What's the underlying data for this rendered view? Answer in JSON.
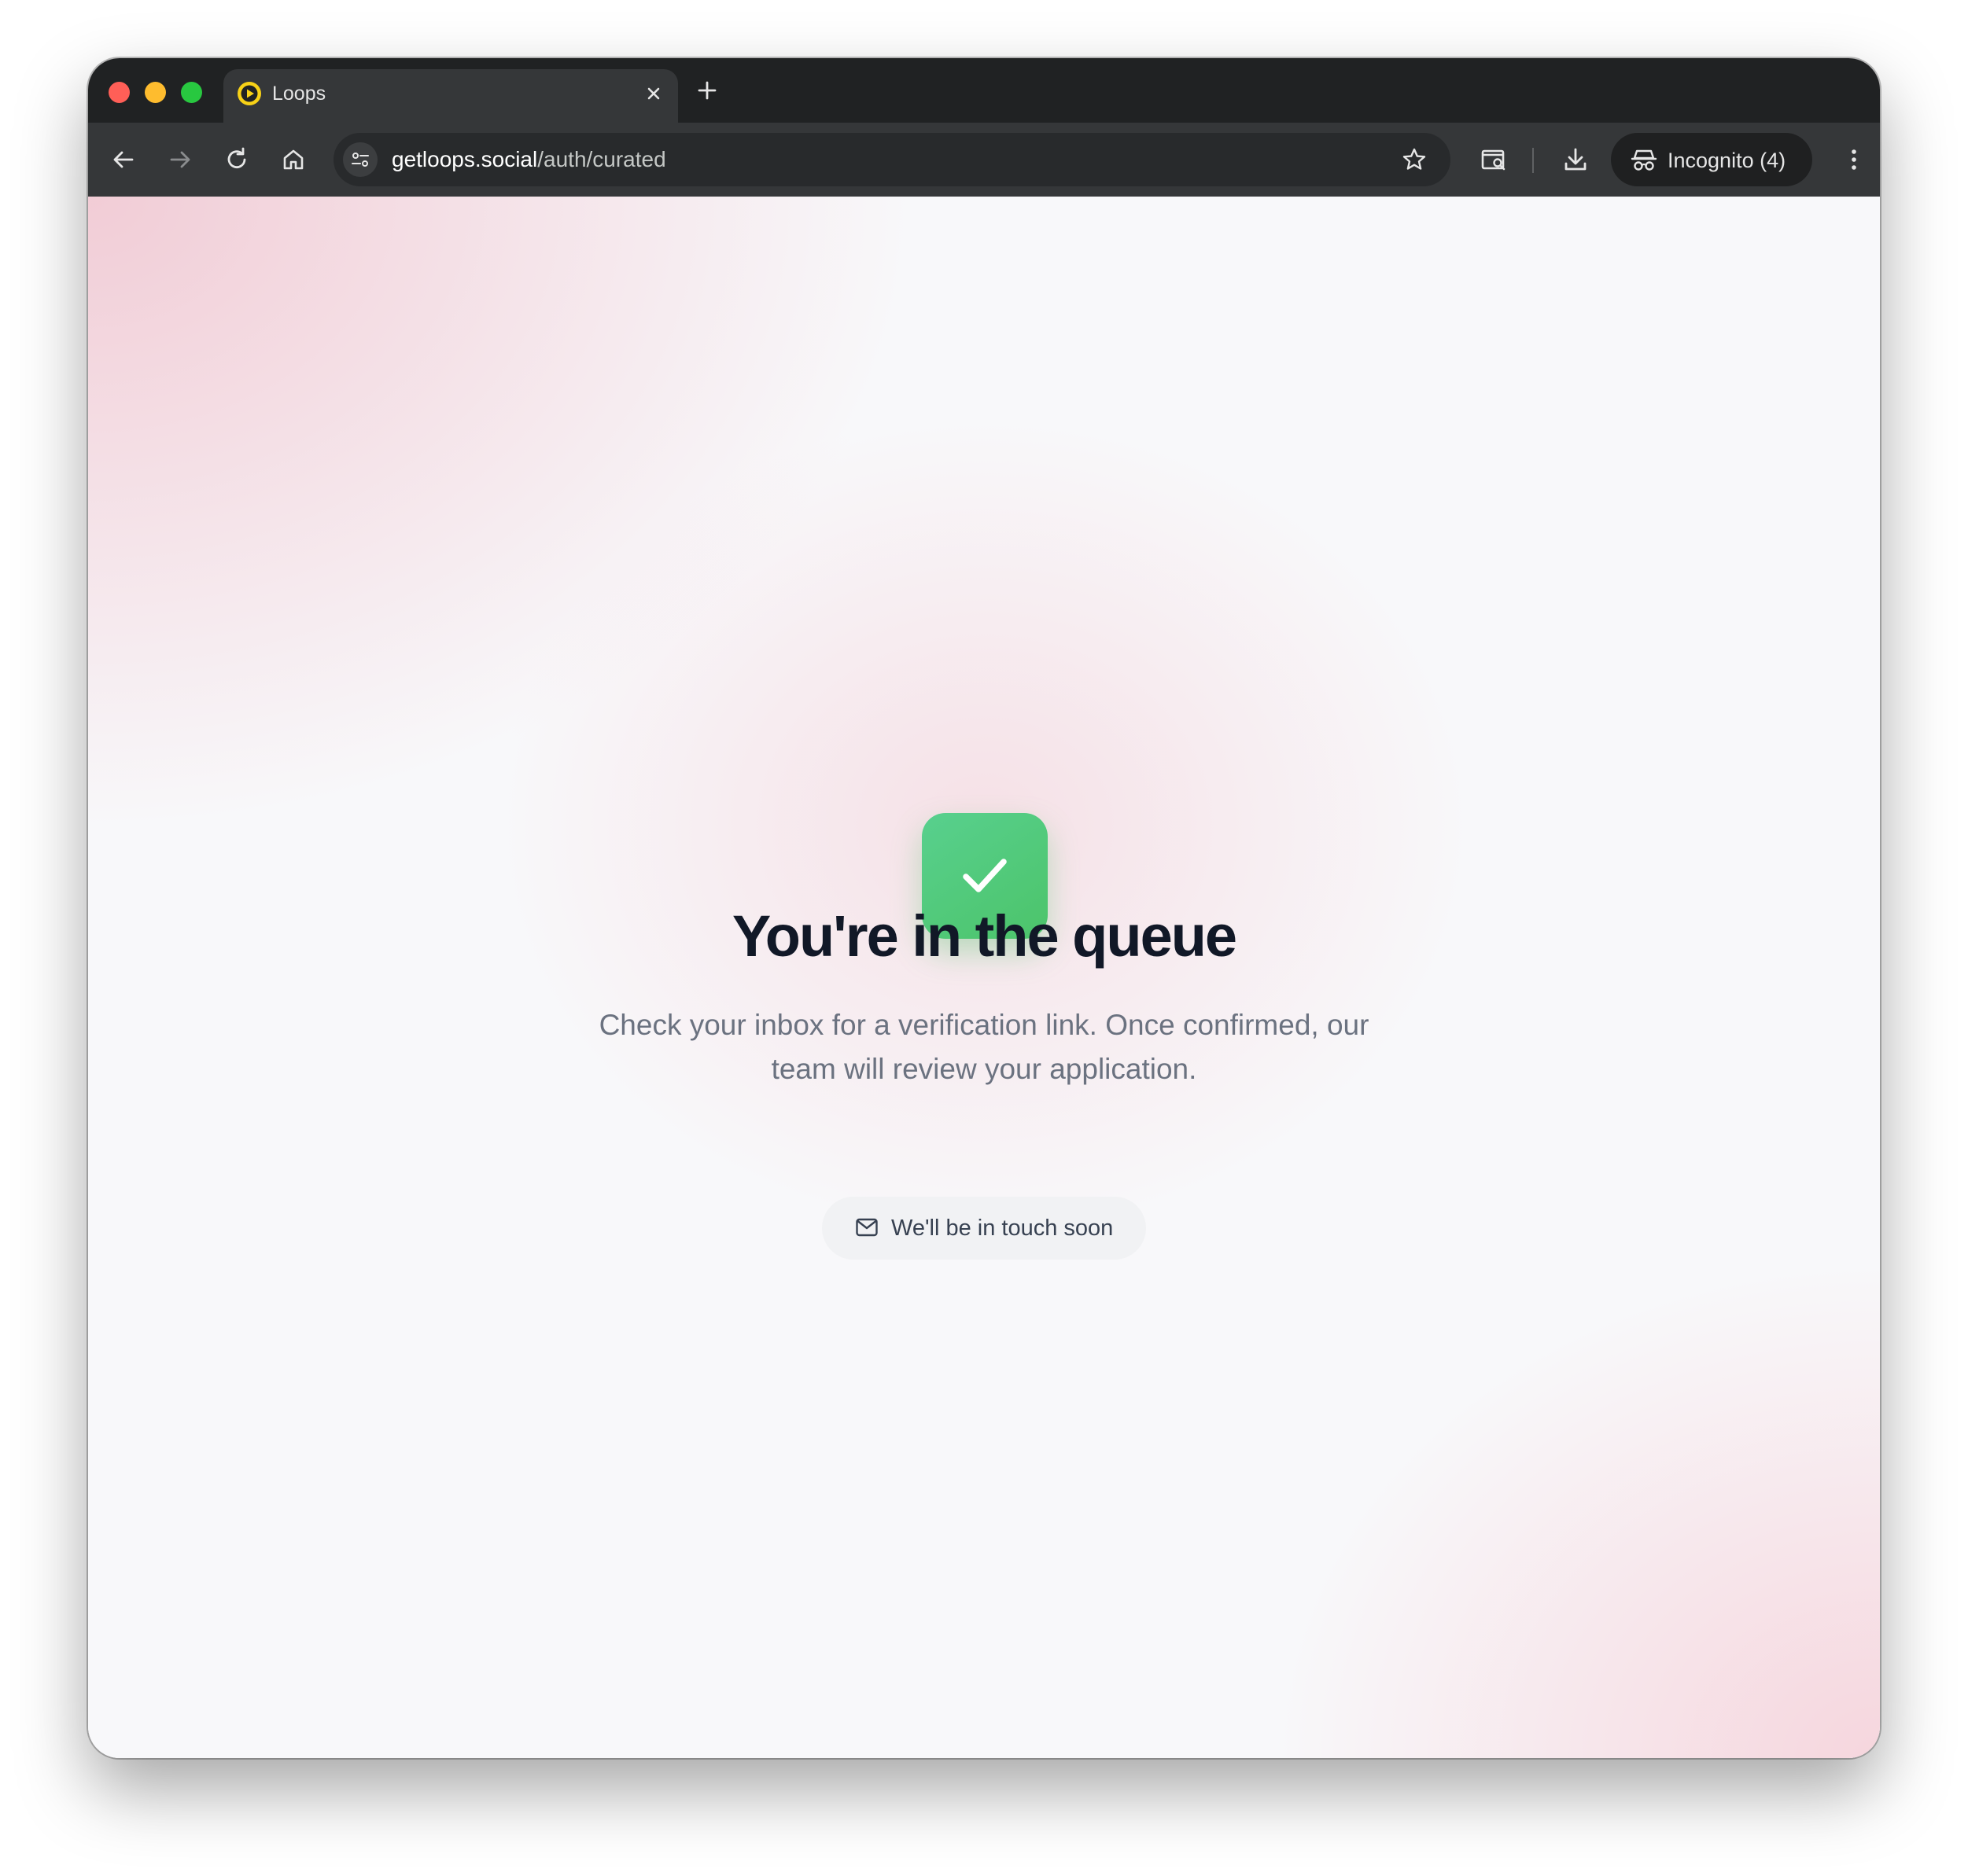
{
  "browser": {
    "tab": {
      "title": "Loops",
      "favicon": "loops-play-icon"
    },
    "omnibox": {
      "domain": "getloops.social",
      "path": "/auth/curated"
    },
    "profile": {
      "label": "Incognito (4)"
    },
    "icons": [
      "back-icon",
      "forward-icon",
      "reload-icon",
      "home-icon",
      "site-info-icon",
      "star-icon",
      "tab-search-icon",
      "download-icon",
      "incognito-icon",
      "menu-icon"
    ]
  },
  "page": {
    "headline": "You're in the queue",
    "message": "Check your inbox for a verification link. Once confirmed, our team will review your application.",
    "status_pill": {
      "label": "We'll be in touch soon",
      "icon": "mail-icon"
    }
  },
  "colors": {
    "success": "#4cc46a",
    "headline": "#111827",
    "muted": "#6b7280",
    "background_tint": "#f1cad4"
  }
}
